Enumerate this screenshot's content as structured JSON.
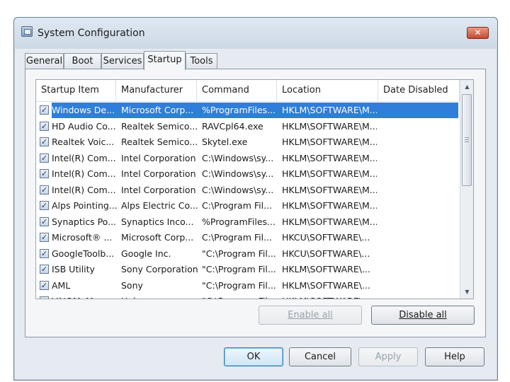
{
  "window": {
    "title": "System Configuration",
    "close_label": "✕"
  },
  "tabs": [
    {
      "label": "General"
    },
    {
      "label": "Boot"
    },
    {
      "label": "Services"
    },
    {
      "label": "Startup",
      "active": true
    },
    {
      "label": "Tools"
    }
  ],
  "list": {
    "columns": [
      "Startup Item",
      "Manufacturer",
      "Command",
      "Location",
      "Date Disabled"
    ],
    "rows": [
      {
        "checked": true,
        "selected": true,
        "item": "Windows De...",
        "manufacturer": "Microsoft Corp...",
        "command": "%ProgramFiles...",
        "location": "HKLM\\SOFTWARE\\M...",
        "date_disabled": ""
      },
      {
        "checked": true,
        "item": "HD Audio Co...",
        "manufacturer": "Realtek Semico...",
        "command": "RAVCpl64.exe",
        "location": "HKLM\\SOFTWARE\\M...",
        "date_disabled": ""
      },
      {
        "checked": true,
        "item": "Realtek Voic...",
        "manufacturer": "Realtek Semico...",
        "command": "Skytel.exe",
        "location": "HKLM\\SOFTWARE\\M...",
        "date_disabled": ""
      },
      {
        "checked": true,
        "item": "Intel(R) Com...",
        "manufacturer": "Intel Corporation",
        "command": "C:\\Windows\\sy...",
        "location": "HKLM\\SOFTWARE\\M...",
        "date_disabled": ""
      },
      {
        "checked": true,
        "item": "Intel(R) Com...",
        "manufacturer": "Intel Corporation",
        "command": "C:\\Windows\\sy...",
        "location": "HKLM\\SOFTWARE\\M...",
        "date_disabled": ""
      },
      {
        "checked": true,
        "item": "Intel(R) Com...",
        "manufacturer": "Intel Corporation",
        "command": "C:\\Windows\\sy...",
        "location": "HKLM\\SOFTWARE\\M...",
        "date_disabled": ""
      },
      {
        "checked": true,
        "item": "Alps Pointing...",
        "manufacturer": "Alps Electric Co...",
        "command": "C:\\Program Fil...",
        "location": "HKLM\\SOFTWARE\\M...",
        "date_disabled": ""
      },
      {
        "checked": true,
        "item": "Synaptics Po...",
        "manufacturer": "Synaptics Inco...",
        "command": "%ProgramFiles...",
        "location": "HKLM\\SOFTWARE\\M...",
        "date_disabled": ""
      },
      {
        "checked": true,
        "item": "Microsoft® ...",
        "manufacturer": "Microsoft Corp...",
        "command": "C:\\Program Fil...",
        "location": "HKCU\\SOFTWARE\\...",
        "date_disabled": ""
      },
      {
        "checked": true,
        "item": "GoogleToolb...",
        "manufacturer": "Google Inc.",
        "command": "\"C:\\Program Fil...",
        "location": "HKCU\\SOFTWARE\\...",
        "date_disabled": ""
      },
      {
        "checked": true,
        "item": "ISB Utility",
        "manufacturer": "Sony Corporation",
        "command": "\"C:\\Program Fil...",
        "location": "HKLM\\SOFTWARE\\...",
        "date_disabled": ""
      },
      {
        "checked": true,
        "item": "AML",
        "manufacturer": "Sony",
        "command": "\"C:\\Program Fil...",
        "location": "HKLM\\SOFTWARE\\...",
        "date_disabled": ""
      },
      {
        "checked": true,
        "item": "VAIOMyMem...",
        "manufacturer": "Unknown",
        "command": "\"C:\\Program Fil...",
        "location": "HKLM\\SOFTWARE\\...",
        "date_disabled": ""
      }
    ]
  },
  "buttons": {
    "enable_all": "Enable all",
    "disable_all": "Disable all",
    "ok": "OK",
    "cancel": "Cancel",
    "apply": "Apply",
    "help": "Help"
  },
  "colors": {
    "selection": "#2f7ed9",
    "window_bg": "#e6ebf1",
    "close_button": "#c54a32"
  },
  "icons": {
    "app": "system-configuration-icon",
    "close": "close-icon",
    "checkbox": "checkmark-icon",
    "scroll_up": "chevron-up-icon",
    "scroll_down": "chevron-down-icon"
  }
}
